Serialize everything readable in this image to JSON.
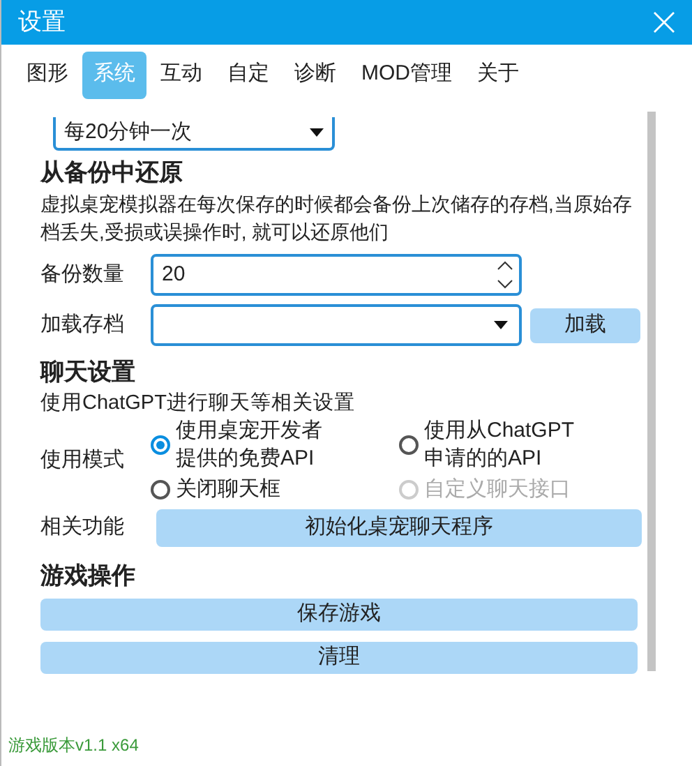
{
  "window": {
    "title": "设置"
  },
  "tabs": [
    {
      "label": "图形",
      "selected": false
    },
    {
      "label": "系统",
      "selected": true
    },
    {
      "label": "互动",
      "selected": false
    },
    {
      "label": "自定",
      "selected": false
    },
    {
      "label": "诊断",
      "selected": false
    },
    {
      "label": "MOD管理",
      "selected": false
    },
    {
      "label": "关于",
      "selected": false
    }
  ],
  "autosave": {
    "value": "每20分钟一次"
  },
  "restore": {
    "heading": "从备份中还原",
    "description": "虚拟桌宠模拟器在每次保存的时候都会备份上次储存的存档,当原始存档丢失,受损或误操作时, 就可以还原他们"
  },
  "backup_count": {
    "label": "备份数量",
    "value": "20"
  },
  "load_save": {
    "label": "加载存档",
    "button": "加载"
  },
  "chat": {
    "heading": "聊天设置",
    "description": "使用ChatGPT进行聊天等相关设置",
    "mode_label": "使用模式",
    "options": [
      {
        "lines": [
          "使用桌宠开发者",
          "提供的免费API"
        ],
        "selected": true,
        "disabled": false
      },
      {
        "lines": [
          "使用从ChatGPT",
          "申请的的API"
        ],
        "selected": false,
        "disabled": false
      },
      {
        "lines": [
          "关闭聊天框"
        ],
        "selected": false,
        "disabled": false
      },
      {
        "lines": [
          "自定义聊天接口"
        ],
        "selected": false,
        "disabled": true
      }
    ],
    "related_label": "相关功能",
    "init_button": "初始化桌宠聊天程序"
  },
  "game": {
    "heading": "游戏操作",
    "buttons": [
      "保存游戏",
      "清理"
    ]
  },
  "version": "游戏版本v1.1 x64"
}
